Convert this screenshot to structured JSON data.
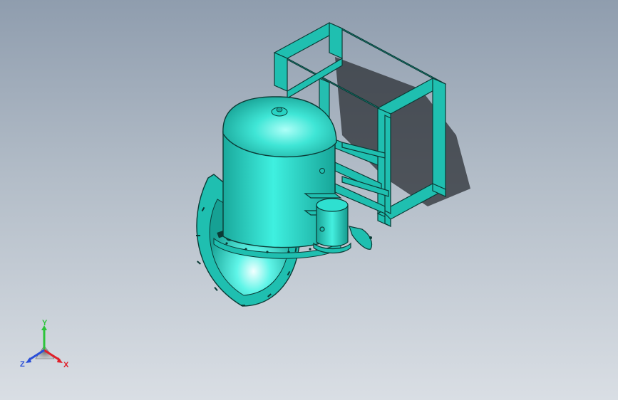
{
  "viewport": {
    "background_top": "#8f9dae",
    "background_bottom": "#d9dee4"
  },
  "model": {
    "primary_color": "#1fbfb0",
    "edge_color": "#0b3b36",
    "components": [
      "tank",
      "domed-lid",
      "lid-fitting",
      "bell-housing",
      "side-pipe",
      "hinged-flap",
      "frame-structure"
    ]
  },
  "triad": {
    "x_label": "X",
    "y_label": "Y",
    "z_label": "Z",
    "x_color": "#e0202a",
    "y_color": "#2cc43a",
    "z_color": "#2a4fd8"
  }
}
